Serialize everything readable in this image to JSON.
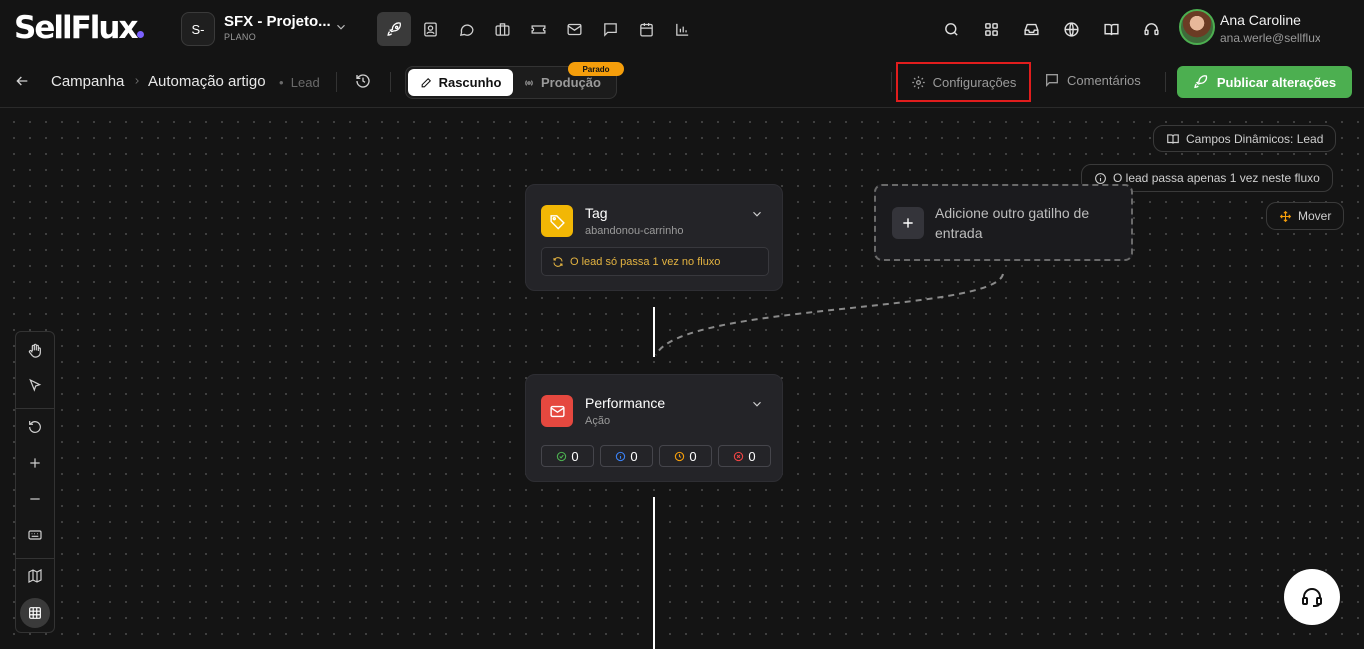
{
  "header": {
    "logo": "SellFlux",
    "project": {
      "avatar_text": "S-",
      "name": "SFX - Projeto...",
      "plan": "PLANO"
    },
    "nav_icons": [
      "rocket-icon",
      "contact-icon",
      "chat-icon",
      "briefcase-icon",
      "ticket-icon",
      "mail-icon",
      "message-icon",
      "calendar-icon",
      "chart-icon"
    ],
    "active_nav": "rocket-icon",
    "right_icons": [
      "search-icon",
      "apps-icon",
      "inbox-icon",
      "globe-icon",
      "book-icon",
      "headset-icon"
    ],
    "user": {
      "name": "Ana Caroline",
      "email": "ana.werle@sellflux..."
    }
  },
  "subbar": {
    "breadcrumb": [
      "Campanha",
      "Automação artigo"
    ],
    "breadcrumb_tag": "Lead",
    "mode": {
      "draft_label": "Rascunho",
      "production_label": "Produção",
      "status_badge": "Parado",
      "active": "draft"
    },
    "settings_label": "Configurações",
    "comments_label": "Comentários",
    "publish_label": "Publicar alterações"
  },
  "canvas": {
    "dynamic_fields_label": "Campos Dinâmicos: Lead",
    "lead_once_info": "O lead passa apenas 1 vez neste fluxo",
    "move_label": "Mover",
    "trigger_node": {
      "title": "Tag",
      "subtitle": "abandonou-carrinho",
      "note": "O lead só passa 1 vez no fluxo"
    },
    "add_trigger_label": "Adicione outro gatilho de entrada",
    "action_node": {
      "title": "Performance",
      "subtitle": "Ação",
      "stats": [
        {
          "icon": "check-circle-icon",
          "value": "0",
          "color": "#4caf50"
        },
        {
          "icon": "info-circle-icon",
          "value": "0",
          "color": "#3b82f6"
        },
        {
          "icon": "clock-icon",
          "value": "0",
          "color": "#f59e0b"
        },
        {
          "icon": "x-circle-icon",
          "value": "0",
          "color": "#ef4444"
        }
      ]
    },
    "tools": [
      "hand-icon",
      "pointer-icon",
      "reset-icon",
      "zoom-in-icon",
      "zoom-out-icon",
      "keyboard-icon",
      "map-icon",
      "grid-icon"
    ],
    "active_tool": "grid-icon"
  },
  "colors": {
    "accent_green": "#4caf50",
    "tag_yellow": "#f2b705",
    "action_red": "#e5483f",
    "highlight_red": "#e11d1d",
    "badge_orange": "#f59e0b"
  }
}
